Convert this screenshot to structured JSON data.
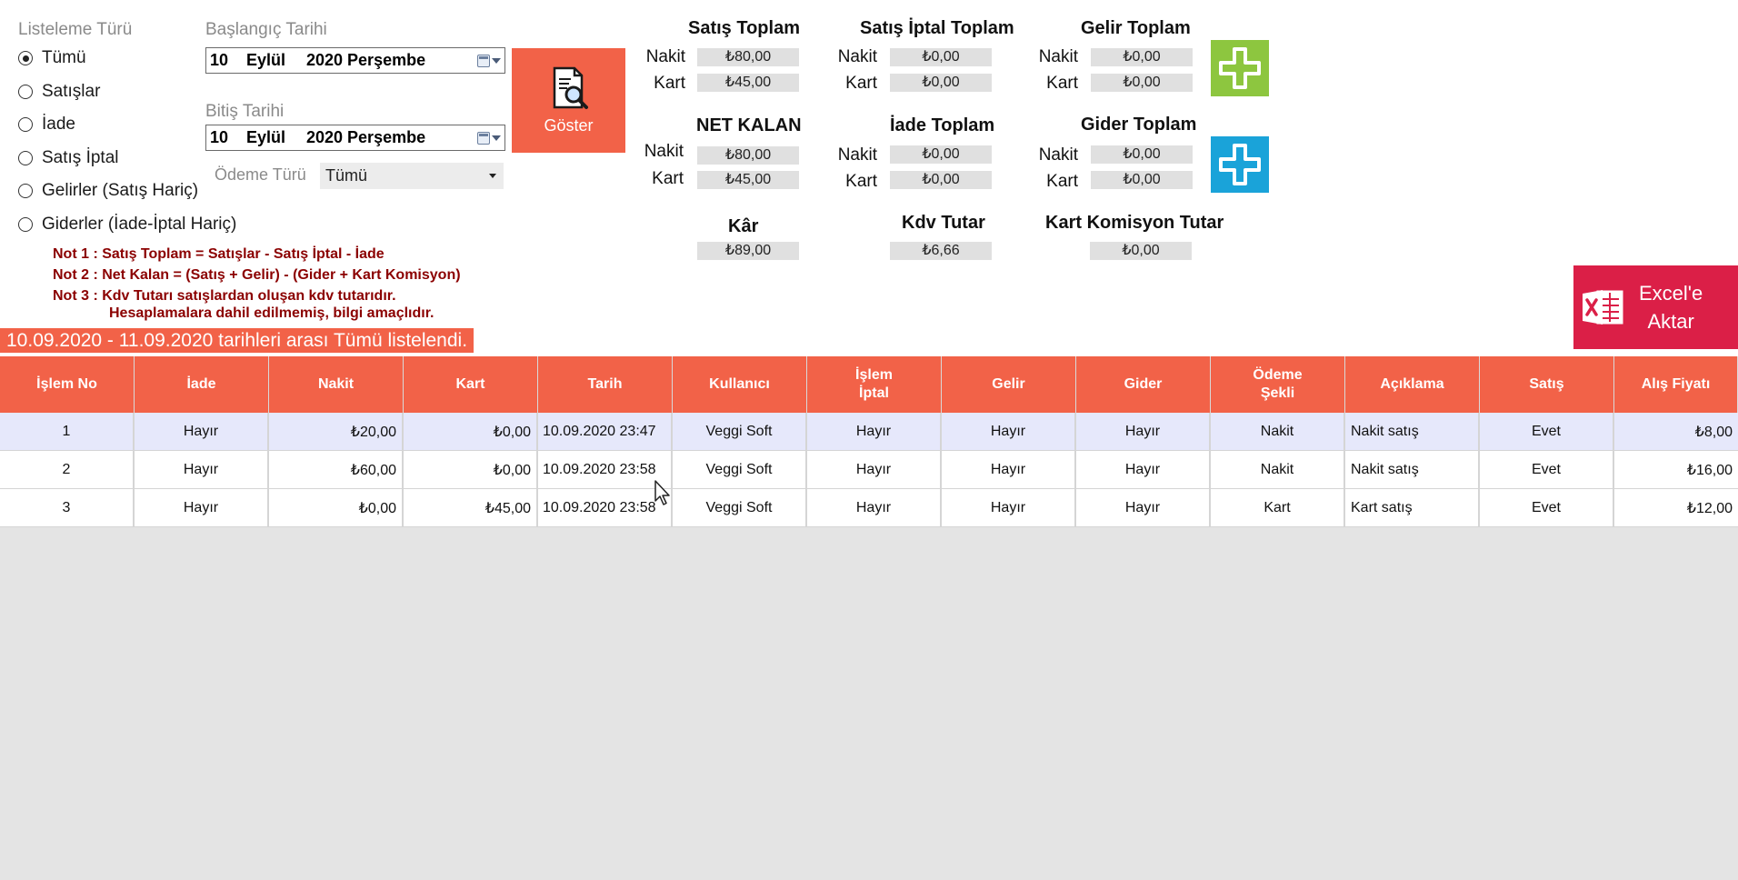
{
  "filter": {
    "group_label": "Listeleme Türü",
    "options": [
      "Tümü",
      "Satışlar",
      "İade",
      "Satış İptal",
      "Gelirler (Satış Hariç)",
      "Giderler (İade-İptal Hariç)"
    ],
    "selected": "Tümü"
  },
  "start_date": {
    "label": "Başlangıç Tarihi",
    "day": "10",
    "month": "Eylül",
    "year_weekday": "2020 Perşembe"
  },
  "end_date": {
    "label": "Bitiş Tarihi",
    "day": "10",
    "month": "Eylül",
    "year_weekday": "2020 Perşembe"
  },
  "payment": {
    "label": "Ödeme Türü",
    "value": "Tümü"
  },
  "show_button": {
    "label": "Göster"
  },
  "notes": {
    "n1": "Not 1 : Satış Toplam = Satışlar - Satış İptal - İade",
    "n2": "Not 2 : Net Kalan = (Satış + Gelir) - (Gider + Kart Komisyon)",
    "n3a": "Not 3 : Kdv Tutarı satışlardan oluşan kdv tutarıdır.",
    "n3b": "Hesaplamalara dahil edilmemiş, bilgi amaçlıdır."
  },
  "status": "10.09.2020 - 11.09.2020 tarihleri arası Tümü listelendi.",
  "labels": {
    "nakit": "Nakit",
    "kart": "Kart"
  },
  "summary": {
    "satis_toplam": {
      "title": "Satış Toplam",
      "nakit": "₺80,00",
      "kart": "₺45,00"
    },
    "satis_iptal_toplam": {
      "title": "Satış İptal Toplam",
      "nakit": "₺0,00",
      "kart": "₺0,00"
    },
    "gelir_toplam": {
      "title": "Gelir Toplam",
      "nakit": "₺0,00",
      "kart": "₺0,00"
    },
    "net_kalan": {
      "title": "NET KALAN",
      "nakit": "₺80,00",
      "kart": "₺45,00"
    },
    "iade_toplam": {
      "title": "İade Toplam",
      "nakit": "₺0,00",
      "kart": "₺0,00"
    },
    "gider_toplam": {
      "title": "Gider Toplam",
      "nakit": "₺0,00",
      "kart": "₺0,00"
    },
    "kar": {
      "title": "Kâr",
      "value": "₺89,00"
    },
    "kdv_tutar": {
      "title": "Kdv Tutar",
      "value": "₺6,66"
    },
    "kart_komisyon": {
      "title": "Kart Komisyon Tutar",
      "value": "₺0,00"
    }
  },
  "excel_button": {
    "line1": "Excel'e",
    "line2": "Aktar"
  },
  "colors": {
    "accent": "#f26248",
    "excel": "#db1f47",
    "add_income": "#8dc63f",
    "add_expense": "#1aa3d9",
    "note_text": "#8b0000"
  },
  "table": {
    "columns": [
      "İşlem No",
      "İade",
      "Nakit",
      "Kart",
      "Tarih",
      "Kullanıcı",
      "İşlem İptal",
      "Gelir",
      "Gider",
      "Ödeme Şekli",
      "Açıklama",
      "Satış",
      "Alış Fiyatı"
    ],
    "rows": [
      [
        "1",
        "Hayır",
        "₺20,00",
        "₺0,00",
        "10.09.2020 23:47",
        "Veggi Soft",
        "Hayır",
        "Hayır",
        "Hayır",
        "Nakit",
        "Nakit satış",
        "Evet",
        "₺8,00"
      ],
      [
        "2",
        "Hayır",
        "₺60,00",
        "₺0,00",
        "10.09.2020 23:58",
        "Veggi Soft",
        "Hayır",
        "Hayır",
        "Hayır",
        "Nakit",
        "Nakit satış",
        "Evet",
        "₺16,00"
      ],
      [
        "3",
        "Hayır",
        "₺0,00",
        "₺45,00",
        "10.09.2020 23:58",
        "Veggi Soft",
        "Hayır",
        "Hayır",
        "Hayır",
        "Kart",
        "Kart satış",
        "Evet",
        "₺12,00"
      ]
    ]
  }
}
